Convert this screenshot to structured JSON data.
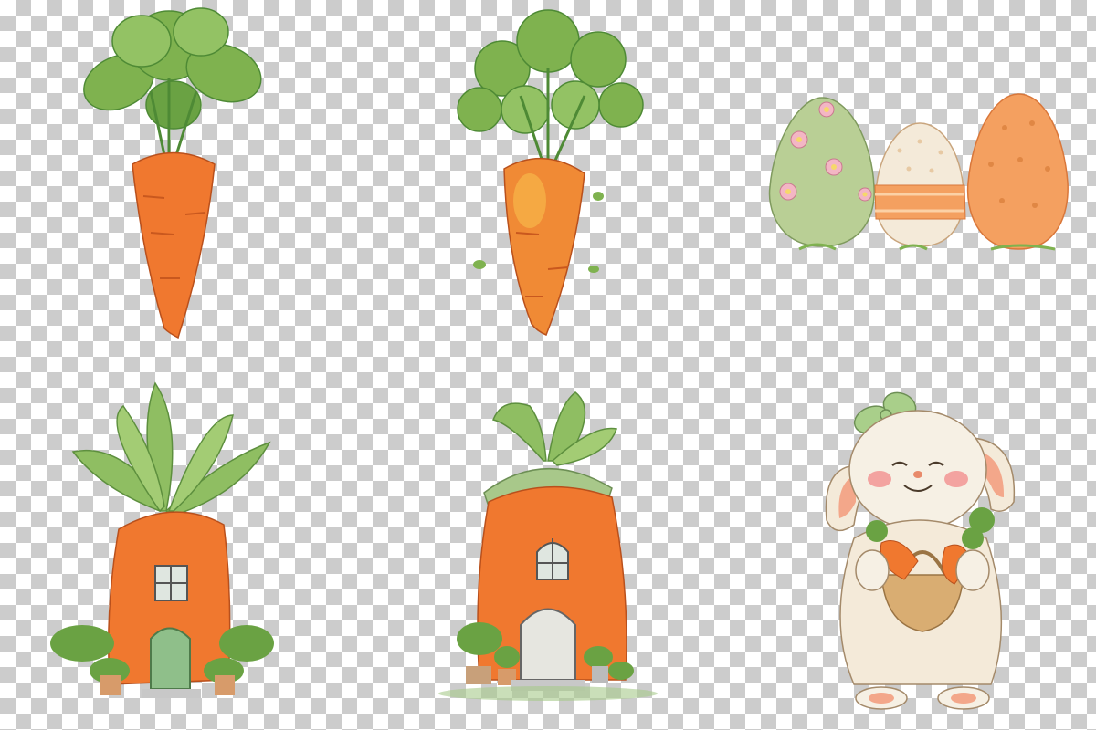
{
  "canvas": {
    "background": "transparency-checkerboard",
    "checker_colors": [
      "#ffffff",
      "#cccccc"
    ]
  },
  "clipart": [
    {
      "id": "carrot-a",
      "subject": "watercolor-carrot-with-leafy-top"
    },
    {
      "id": "carrot-b",
      "subject": "watercolor-carrot-with-parsley-top"
    },
    {
      "id": "eggs",
      "subject": "three-easter-eggs",
      "egg_colors": [
        "#b9cf95",
        "#f2e3cc",
        "#f4a060"
      ]
    },
    {
      "id": "house-a",
      "subject": "carrot-house-with-green-door"
    },
    {
      "id": "house-b",
      "subject": "carrot-house-with-roof-and-arched-door"
    },
    {
      "id": "bunny",
      "subject": "bunny-holding-basket-of-carrots"
    }
  ],
  "colors": {
    "carrot": "#f0782f",
    "carrot_dark": "#d9581e",
    "leaf": "#7fb24f",
    "leaf_dark": "#4e8a35",
    "cream": "#f4ead9",
    "door_green": "#8fbf8a",
    "pink": "#f3a3a0"
  }
}
